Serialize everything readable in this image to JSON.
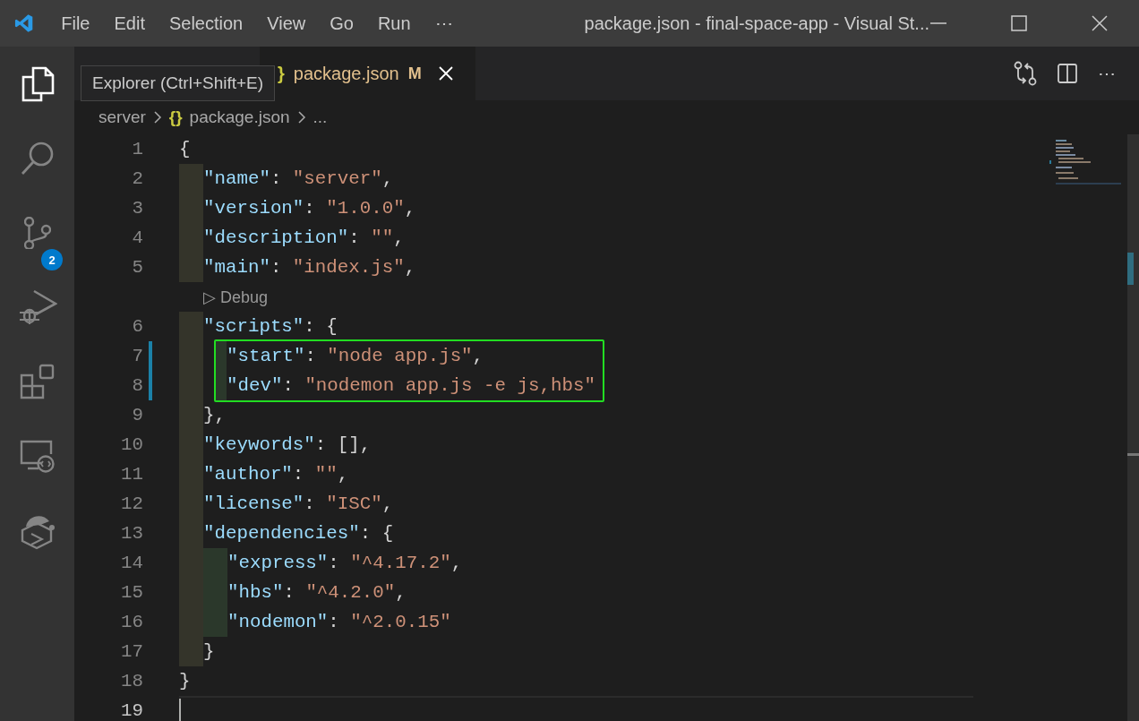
{
  "window": {
    "title": "package.json - final-space-app - Visual St...",
    "menu": [
      "File",
      "Edit",
      "Selection",
      "View",
      "Go",
      "Run",
      "⋯"
    ]
  },
  "activity_bar": [
    {
      "kind": "explorer",
      "selected": true
    },
    {
      "kind": "search",
      "selected": false
    },
    {
      "kind": "source-control",
      "selected": false,
      "badge": "2"
    },
    {
      "kind": "run-debug",
      "selected": false
    },
    {
      "kind": "extensions",
      "selected": false
    },
    {
      "kind": "remote",
      "selected": false
    },
    {
      "kind": "hat-extension",
      "selected": false
    }
  ],
  "tooltip": "Explorer (Ctrl+Shift+E)",
  "tabs": [
    {
      "icon": "}",
      "label": "package.json",
      "status": "M",
      "selected": true,
      "modified": true
    }
  ],
  "editor_actions": {
    "more": "⋯"
  },
  "breadcrumbs": [
    {
      "text": "server"
    },
    {
      "icon": "{}",
      "text": "package.json"
    },
    {
      "text": "..."
    }
  ],
  "code": [
    {
      "kind": "line",
      "number": "1",
      "tokens": [
        {
          "kind": "punct",
          "text": "{"
        }
      ],
      "children": [
        {
          "kind": "line",
          "number": "2",
          "tokens": [
            {
              "kind": "key",
              "text": "\"name\""
            },
            {
              "kind": "punct",
              "text": ": "
            },
            {
              "kind": "string",
              "text": "\"server\""
            },
            {
              "kind": "punct",
              "text": ","
            }
          ]
        },
        {
          "kind": "line",
          "number": "3",
          "tokens": [
            {
              "kind": "key",
              "text": "\"version\""
            },
            {
              "kind": "punct",
              "text": ": "
            },
            {
              "kind": "string",
              "text": "\"1.0.0\""
            },
            {
              "kind": "punct",
              "text": ","
            }
          ]
        },
        {
          "kind": "line",
          "number": "4",
          "tokens": [
            {
              "kind": "key",
              "text": "\"description\""
            },
            {
              "kind": "punct",
              "text": ": "
            },
            {
              "kind": "string",
              "text": "\"\""
            },
            {
              "kind": "punct",
              "text": ","
            }
          ]
        },
        {
          "kind": "line",
          "number": "5",
          "tokens": [
            {
              "kind": "key",
              "text": "\"main\""
            },
            {
              "kind": "punct",
              "text": ": "
            },
            {
              "kind": "string",
              "text": "\"index.js\""
            },
            {
              "kind": "punct",
              "text": ","
            }
          ]
        },
        {
          "kind": "codelens",
          "icon": "▷",
          "text": "Debug"
        },
        {
          "kind": "line",
          "number": "6",
          "tokens": [
            {
              "kind": "key",
              "text": "\"scripts\""
            },
            {
              "kind": "punct",
              "text": ": {"
            }
          ],
          "children": [
            {
              "kind": "line",
              "number": "7",
              "modified": true,
              "highlighted": true,
              "tokens": [
                {
                  "kind": "key",
                  "text": "\"start\""
                },
                {
                  "kind": "punct",
                  "text": ": "
                },
                {
                  "kind": "string",
                  "text": "\"node app.js\""
                },
                {
                  "kind": "punct",
                  "text": ","
                }
              ]
            },
            {
              "kind": "line",
              "number": "8",
              "modified": true,
              "highlighted": true,
              "tokens": [
                {
                  "kind": "key",
                  "text": "\"dev\""
                },
                {
                  "kind": "punct",
                  "text": ": "
                },
                {
                  "kind": "string",
                  "text": "\"nodemon app.js -e js,hbs\""
                }
              ]
            }
          ]
        },
        {
          "kind": "line",
          "number": "9",
          "tokens": [
            {
              "kind": "punct",
              "text": "},"
            }
          ]
        },
        {
          "kind": "line",
          "number": "10",
          "tokens": [
            {
              "kind": "key",
              "text": "\"keywords\""
            },
            {
              "kind": "punct",
              "text": ": [],"
            }
          ]
        },
        {
          "kind": "line",
          "number": "11",
          "tokens": [
            {
              "kind": "key",
              "text": "\"author\""
            },
            {
              "kind": "punct",
              "text": ": "
            },
            {
              "kind": "string",
              "text": "\"\""
            },
            {
              "kind": "punct",
              "text": ","
            }
          ]
        },
        {
          "kind": "line",
          "number": "12",
          "tokens": [
            {
              "kind": "key",
              "text": "\"license\""
            },
            {
              "kind": "punct",
              "text": ": "
            },
            {
              "kind": "string",
              "text": "\"ISC\""
            },
            {
              "kind": "punct",
              "text": ","
            }
          ]
        },
        {
          "kind": "line",
          "number": "13",
          "tokens": [
            {
              "kind": "key",
              "text": "\"dependencies\""
            },
            {
              "kind": "punct",
              "text": ": {"
            }
          ],
          "children": [
            {
              "kind": "line",
              "number": "14",
              "tokens": [
                {
                  "kind": "key",
                  "text": "\"express\""
                },
                {
                  "kind": "punct",
                  "text": ": "
                },
                {
                  "kind": "string",
                  "text": "\"^4.17.2\""
                },
                {
                  "kind": "punct",
                  "text": ","
                }
              ]
            },
            {
              "kind": "line",
              "number": "15",
              "tokens": [
                {
                  "kind": "key",
                  "text": "\"hbs\""
                },
                {
                  "kind": "punct",
                  "text": ": "
                },
                {
                  "kind": "string",
                  "text": "\"^4.2.0\""
                },
                {
                  "kind": "punct",
                  "text": ","
                }
              ]
            },
            {
              "kind": "line",
              "number": "16",
              "tokens": [
                {
                  "kind": "key",
                  "text": "\"nodemon\""
                },
                {
                  "kind": "punct",
                  "text": ": "
                },
                {
                  "kind": "string",
                  "text": "\"^2.0.15\""
                }
              ]
            }
          ]
        },
        {
          "kind": "line",
          "number": "17",
          "tokens": [
            {
              "kind": "punct",
              "text": "}"
            }
          ]
        }
      ]
    },
    {
      "kind": "line",
      "number": "18",
      "tokens": [
        {
          "kind": "punct",
          "text": "}"
        }
      ]
    },
    {
      "kind": "line",
      "number": "19",
      "current": true
    }
  ]
}
